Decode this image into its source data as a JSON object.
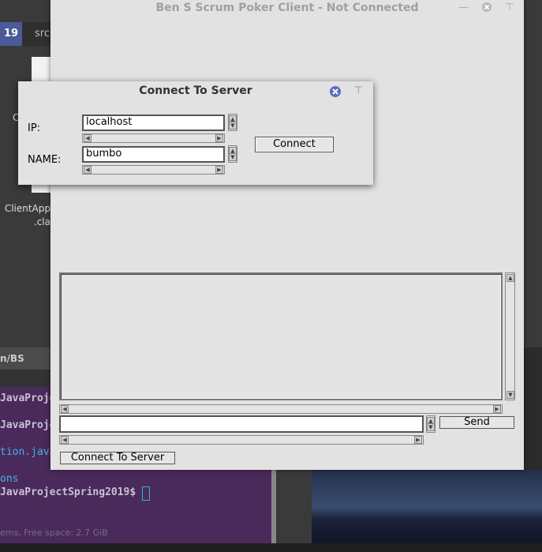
{
  "desktop": {
    "tab_active": "19",
    "tab_src": "src",
    "file_label_line1": "ClientApp",
    "file_label_line2": ".cla",
    "file_left_char": "C",
    "path_bar": "n/BS STICK",
    "terminal_lines": [
      "JavaProje",
      "JavaProje",
      "tion.java",
      "ons",
      "JavaProjectSpring2019$"
    ],
    "status_text": "ems, Free space: 2.7 GiB"
  },
  "main_window": {
    "title": "Ben S Scrum Poker Client - Not Connected",
    "send_label": "Send",
    "connect_to_server_label": "Connect To Server",
    "message_input_value": "",
    "chat_area_text": ""
  },
  "dialog": {
    "title": "Connect To Server",
    "ip_label": "IP:",
    "ip_value": "localhost",
    "name_label": "NAME:",
    "name_value": "bumbo",
    "connect_label": "Connect"
  },
  "colors": {
    "accent_tab": "#4a5a9a",
    "terminal_bg": "#4a2a5a",
    "window_bg": "#e2e2e2",
    "close_icon": "#5a6fc0"
  }
}
